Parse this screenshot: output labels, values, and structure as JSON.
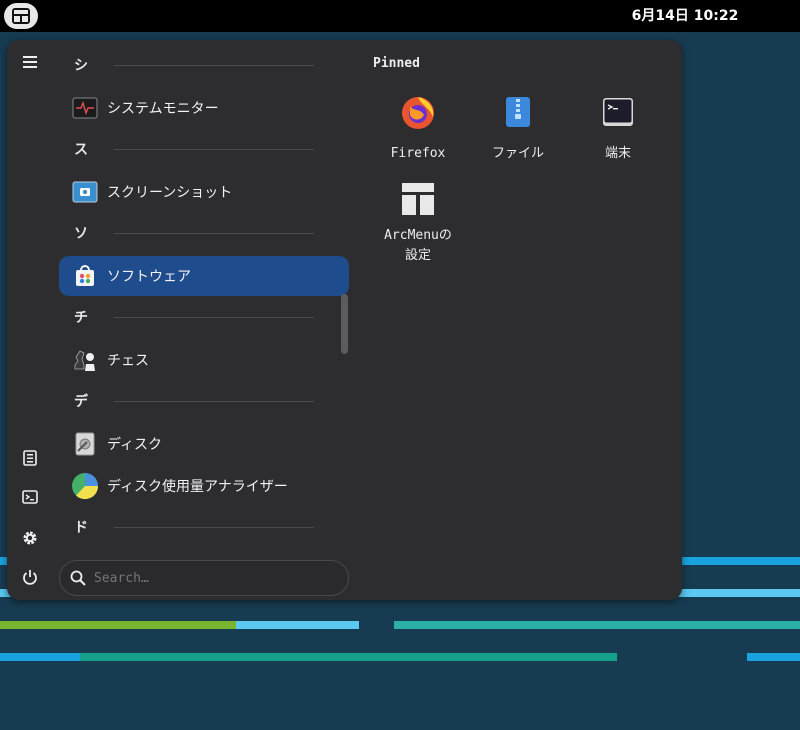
{
  "topbar": {
    "clock": "6月14日  10:22"
  },
  "menu": {
    "categories": [
      {
        "letter": "シ"
      },
      {
        "letter": "ス"
      },
      {
        "letter": "ソ"
      },
      {
        "letter": "チ"
      },
      {
        "letter": "デ"
      },
      {
        "letter": "ド"
      }
    ],
    "apps": [
      {
        "label": "システムモニター",
        "icon": "system-monitor-icon"
      },
      {
        "label": "スクリーンショット",
        "icon": "screenshot-icon"
      },
      {
        "label": "ソフトウェア",
        "icon": "software-icon",
        "selected": true
      },
      {
        "label": "チェス",
        "icon": "chess-icon"
      },
      {
        "label": "ディスク",
        "icon": "disks-icon"
      },
      {
        "label": "ディスク使用量アナライザー",
        "icon": "disk-usage-analyzer-icon"
      }
    ],
    "search": {
      "placeholder": "Search…"
    },
    "pinned": {
      "title": "Pinned",
      "items": [
        {
          "label": "Firefox",
          "icon": "firefox-icon"
        },
        {
          "label": "ファイル",
          "icon": "files-icon"
        },
        {
          "label": "端末",
          "icon": "terminal-icon"
        },
        {
          "label": "ArcMenuの設定",
          "icon": "arcmenu-settings-icon"
        }
      ]
    }
  },
  "colors": {
    "desktop": "#173c52",
    "menu_bg": "#2d2d2f",
    "selected": "#1e4c8c",
    "accent_blue": "#1aa3e0",
    "accent_teal": "#2ab0a8",
    "accent_green": "#7ab532"
  }
}
